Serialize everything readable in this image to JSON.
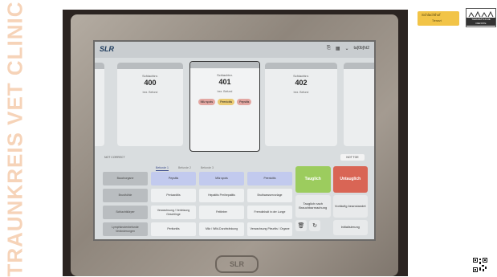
{
  "watermark": "TRAUNKREIS VET CLINIC",
  "screen": {
    "app_logo": "SLR",
    "status": {
      "user": "ta[0b]ht2"
    },
    "cards": [
      {
        "label": "Schlachtnr.",
        "number": "400",
        "sub": "bez. Befund"
      },
      {
        "label": "Schlachtnr.",
        "number": "401",
        "sub": "bez. Befund",
        "tags": [
          {
            "text": "Milz spots"
          },
          {
            "text": "Peenicitis"
          },
          {
            "text": "Pepsitis"
          }
        ]
      },
      {
        "label": "Schlachtnr.",
        "number": "402",
        "sub": "bez. Befund"
      }
    ],
    "under_left": "NOT CORRECT",
    "next_button": "NOT TOE",
    "tabs": [
      "Befunde 1",
      "Befunde 2",
      "Befunde 3"
    ],
    "grid": [
      [
        "Bauchorgane",
        "Pepsitis",
        "Milz spots",
        "Peenicitis"
      ],
      [
        "Brusthöhle",
        "Pericarditis",
        "Hepatitis Perihepatitis",
        "Bruthwasservorlage"
      ],
      [
        "Schlachtkörper",
        "Verwachsung / Verletzung Geschlinge",
        "Fettleber",
        "Fremdinhalt in der Lunge"
      ],
      [
        "Lymphknotenbefunde Veränderungen",
        "Peritonitis",
        "Milz / Wild-Durchtränkung",
        "Verwachsung Pleuritis / Organe"
      ]
    ],
    "actions": {
      "tauglich": "Tauglich",
      "untauglich": "Untauglich",
      "tauglich_nach": "Tauglich nach Brauchbarmachung",
      "vorlaeufig": "Vorläufig beanstandet",
      "delete_icon": "trash-icon",
      "refresh_icon": "refresh-icon",
      "initialisierung": "Initialisierung"
    },
    "bezel_logo": "SLR"
  },
  "logos": {
    "left": {
      "line1": "Schlachthof",
      "line2": "Tierarzt"
    },
    "right": {
      "label": "TIERARZTLICHE DIENSTE"
    }
  }
}
